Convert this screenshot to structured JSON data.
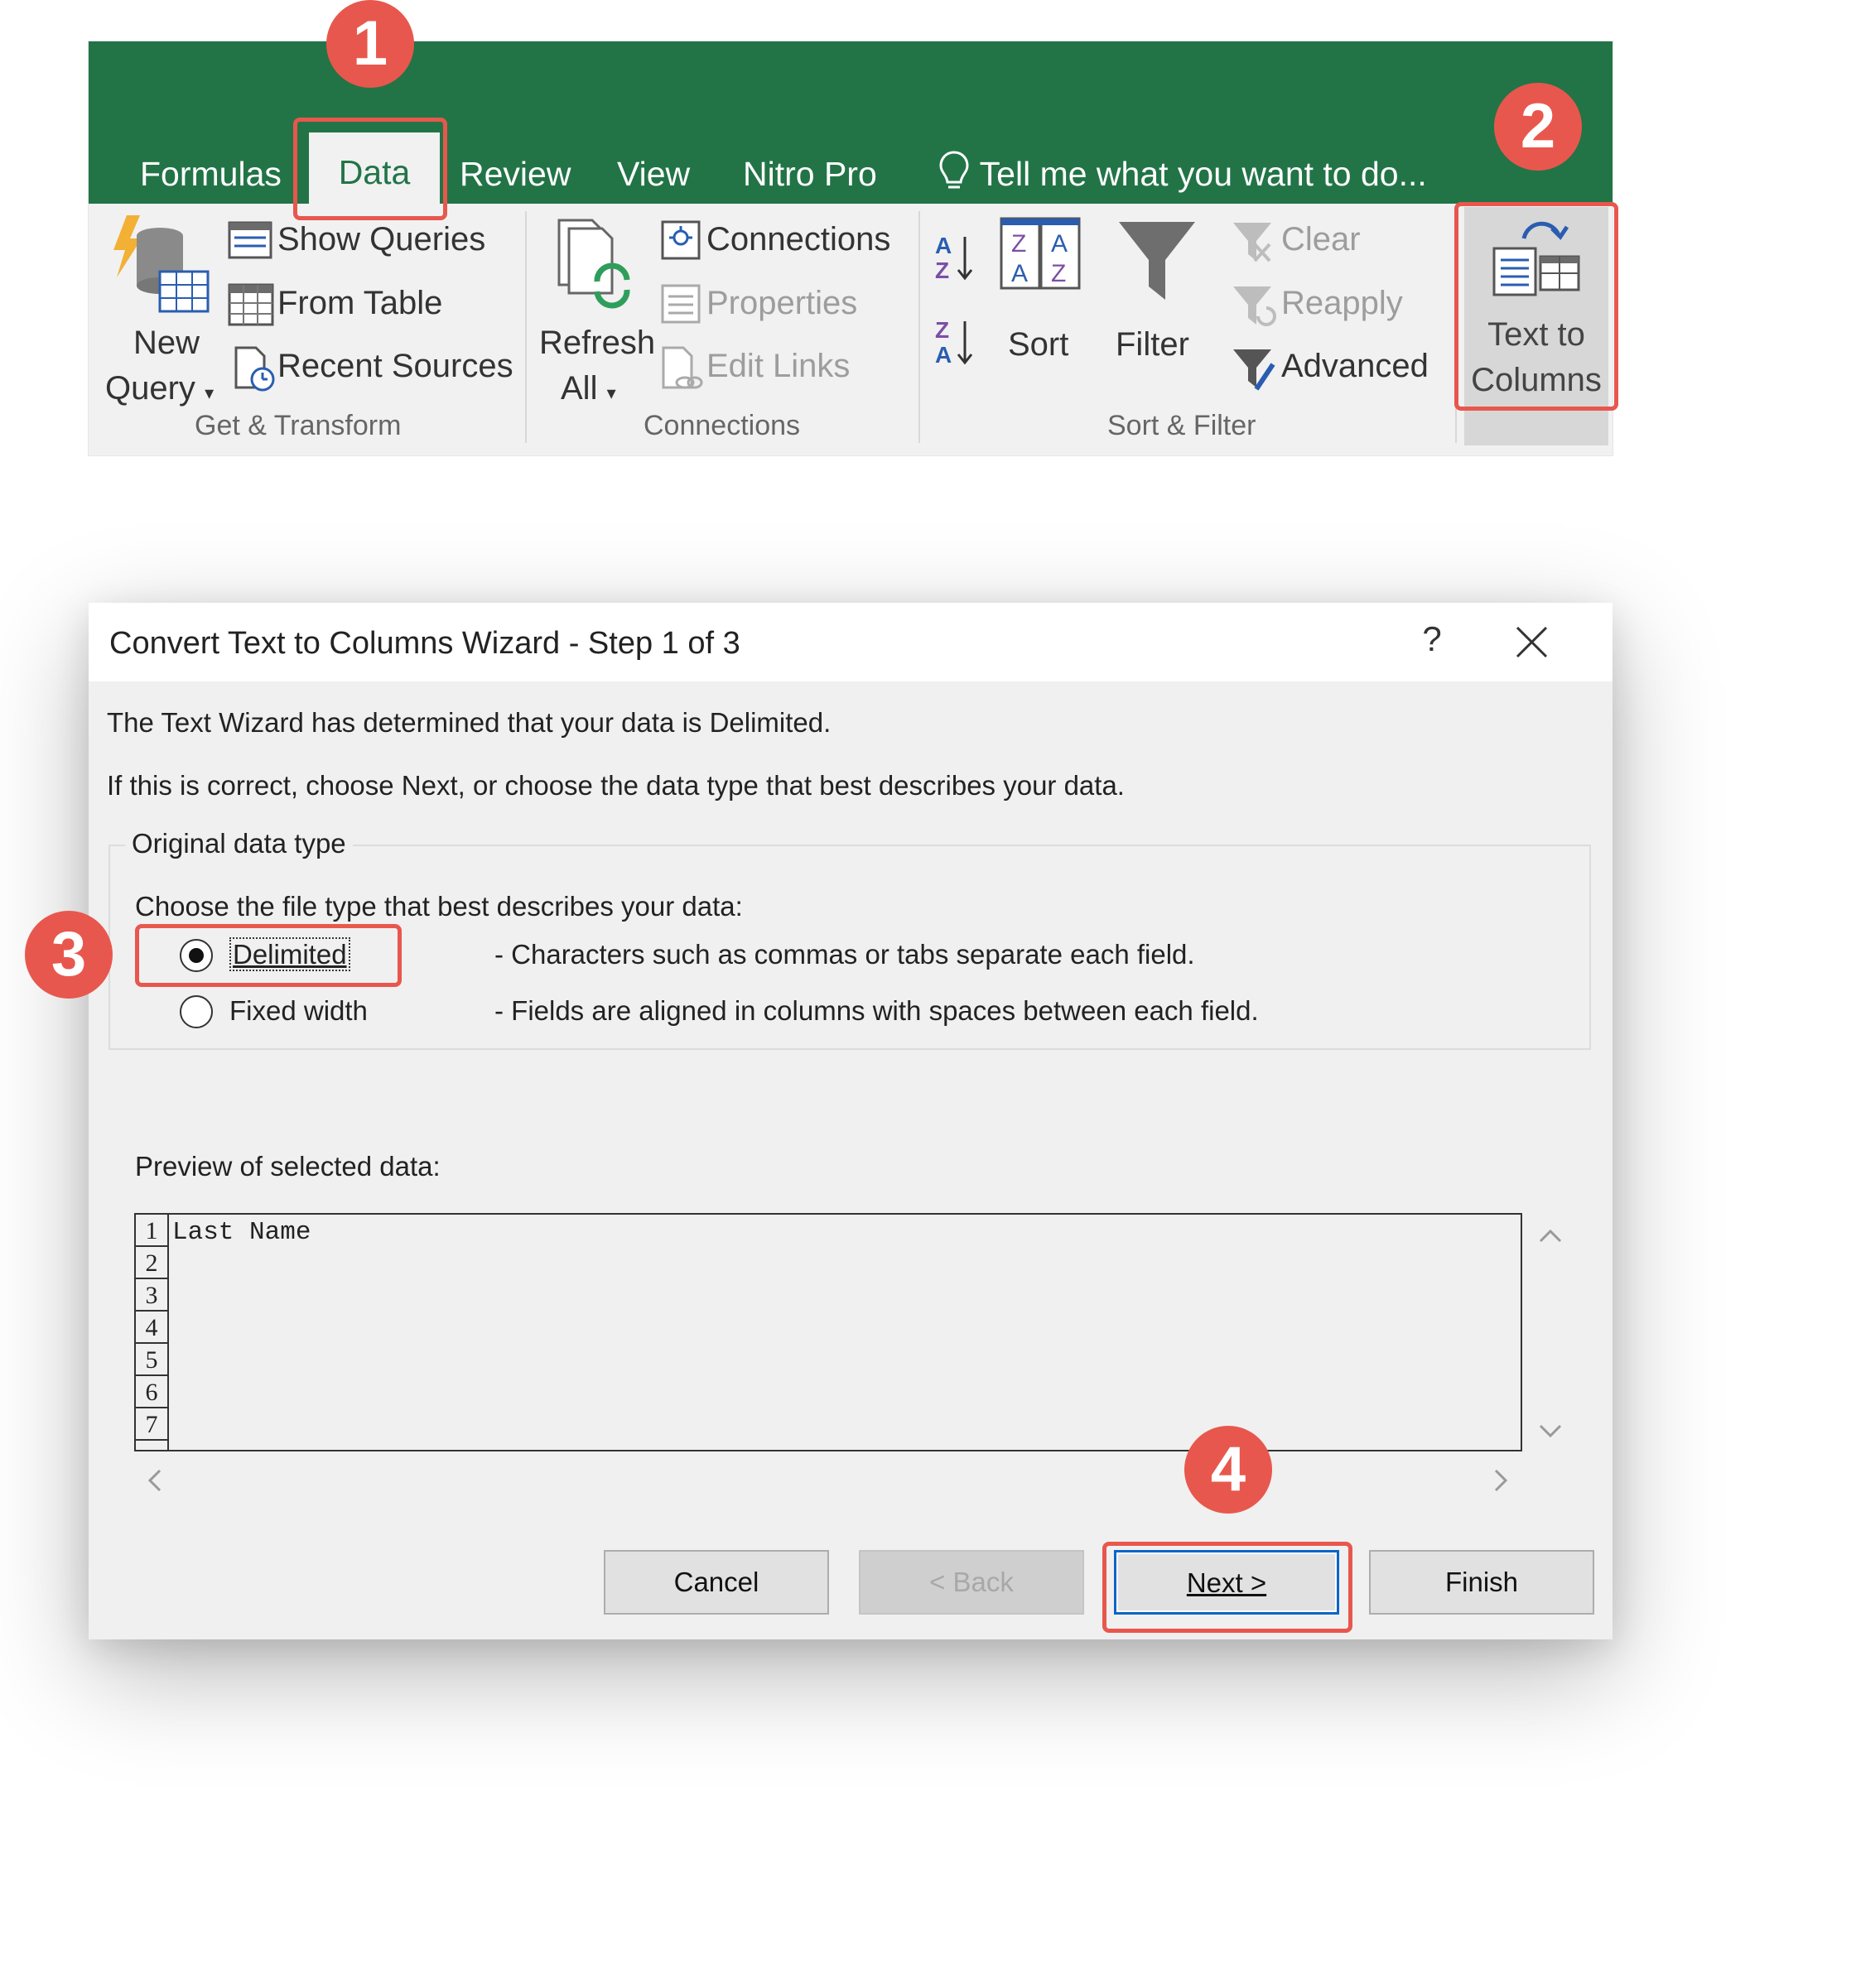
{
  "ribbon": {
    "tabs": [
      "Formulas",
      "Data",
      "Review",
      "View",
      "Nitro Pro"
    ],
    "active_tab": "Data",
    "tell_me": "Tell me what you want to do...",
    "get_transform": {
      "new_query": [
        "New",
        "Query"
      ],
      "show_queries": "Show Queries",
      "from_table": "From Table",
      "recent_sources": "Recent Sources",
      "label": "Get & Transform"
    },
    "connections": {
      "refresh_all": [
        "Refresh",
        "All"
      ],
      "connections": "Connections",
      "properties": "Properties",
      "edit_links": "Edit Links",
      "label": "Connections"
    },
    "sort_filter": {
      "sort": "Sort",
      "filter": "Filter",
      "clear": "Clear",
      "reapply": "Reapply",
      "advanced": "Advanced",
      "label": "Sort & Filter"
    },
    "data_tools": {
      "text_to_columns": [
        "Text to",
        "Columns"
      ]
    }
  },
  "dialog": {
    "title": "Convert Text to Columns Wizard - Step 1 of 3",
    "help": "?",
    "intro_line1": "The Text Wizard has determined that your data is Delimited.",
    "intro_line2": "If this is correct, choose Next, or choose the data type that best describes your data.",
    "group_label": "Original data type",
    "choose_label": "Choose the file type that best describes your data:",
    "options": [
      {
        "label": "Delimited",
        "description": "- Characters such as commas or tabs separate each field.",
        "selected": true
      },
      {
        "label": "Fixed width",
        "description": "- Fields are aligned in columns with spaces between each field.",
        "selected": false
      }
    ],
    "preview_label": "Preview of selected data:",
    "preview_line_numbers": [
      "1",
      "2",
      "3",
      "4",
      "5",
      "6",
      "7"
    ],
    "preview_rows": [
      "Last Name"
    ],
    "buttons": {
      "cancel": "Cancel",
      "back": "< Back",
      "next": "Next >",
      "finish": "Finish"
    }
  },
  "annotations": {
    "badges": [
      "1",
      "2",
      "3",
      "4"
    ],
    "color": "#e8574d"
  },
  "colors": {
    "excel_green": "#227447",
    "default_button_border": "#0a64c8"
  }
}
